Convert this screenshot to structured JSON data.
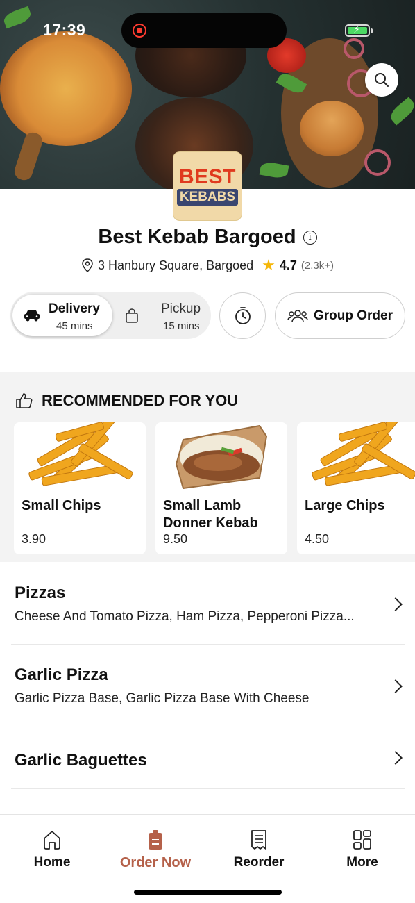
{
  "status_bar": {
    "time": "17:39"
  },
  "restaurant": {
    "logo_top": "BEST",
    "logo_bottom": "KEBABS",
    "name": "Best Kebab Bargoed",
    "address": "3 Hanbury Square, Bargoed",
    "rating": "4.7",
    "reviews": "(2.3k+)"
  },
  "modes": {
    "delivery": {
      "label": "Delivery",
      "time": "45 mins"
    },
    "pickup": {
      "label": "Pickup",
      "time": "15 mins"
    },
    "group_order": "Group Order"
  },
  "recommended": {
    "heading": "RECOMMENDED FOR YOU",
    "items": [
      {
        "name": "Small Chips",
        "price": "3.90"
      },
      {
        "name": "Small Lamb Donner Kebab",
        "price": "9.50"
      },
      {
        "name": "Large Chips",
        "price": "4.50"
      }
    ]
  },
  "menu": [
    {
      "name": "Pizzas",
      "desc": "Cheese And Tomato Pizza, Ham Pizza, Pepperoni Pizza..."
    },
    {
      "name": "Garlic Pizza",
      "desc": "Garlic Pizza Base, Garlic Pizza Base With Cheese"
    },
    {
      "name": "Garlic Baguettes",
      "desc": ""
    }
  ],
  "tabbar": [
    {
      "label": "Home",
      "icon": "home-icon"
    },
    {
      "label": "Order Now",
      "icon": "order-bag-icon"
    },
    {
      "label": "Reorder",
      "icon": "receipt-icon"
    },
    {
      "label": "More",
      "icon": "grid-icon"
    }
  ],
  "colors": {
    "accent": "#b5614a",
    "star": "#f5b70a",
    "logo_red": "#e03a1e",
    "logo_navy": "#3a4670"
  }
}
